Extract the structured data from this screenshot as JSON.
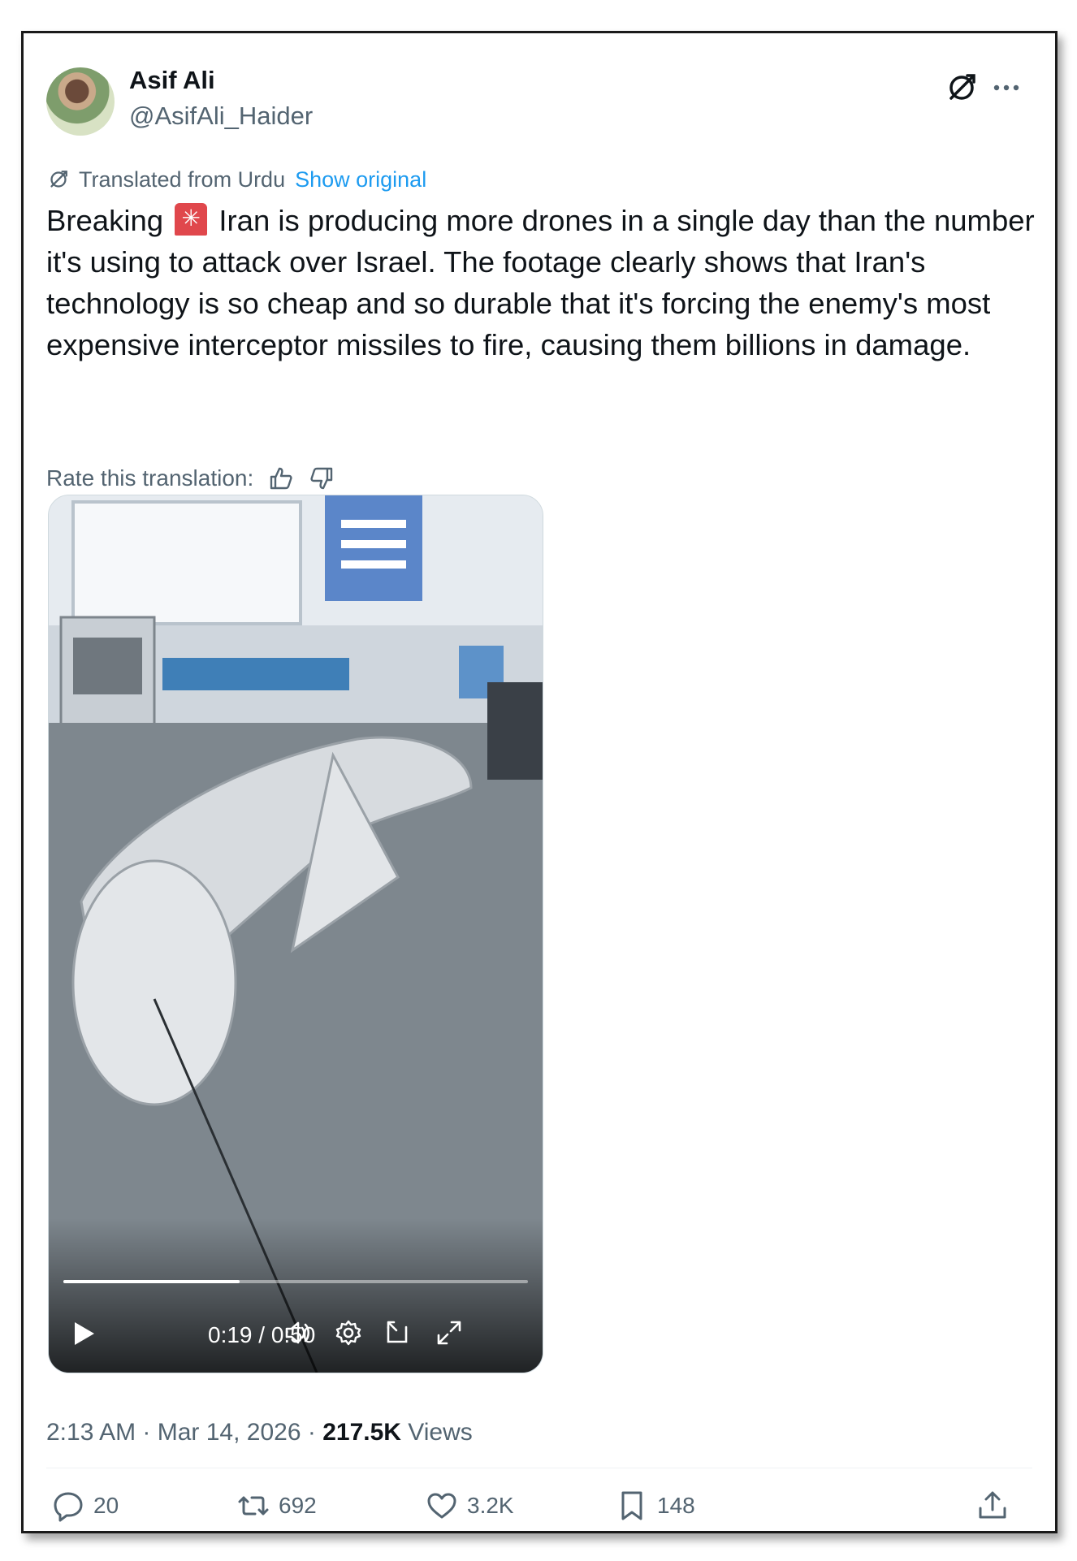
{
  "author": {
    "name": "Asif Ali",
    "handle": "@AsifAli_Haider"
  },
  "translation": {
    "label": "Translated from Urdu",
    "show_original": "Show original",
    "rate_label": "Rate this translation:"
  },
  "tweet": {
    "text_before": "Breaking",
    "text_after": " Iran is producing more drones in a single day than the number it's using to attack over Israel. The footage clearly shows that Iran's technology is so cheap and so durable that it's forcing the enemy's most expensive interceptor missiles to fire, causing them billions in damage."
  },
  "video": {
    "time": "0:19 / 0:50",
    "progress_fraction": 0.38
  },
  "meta": {
    "time": "2:13 AM",
    "date": "Mar 14, 2026",
    "views_count": "217.5K",
    "views_label": "Views"
  },
  "actions": {
    "replies": "20",
    "reposts": "692",
    "likes": "3.2K",
    "bookmarks": "148"
  },
  "colors": {
    "link": "#1d9bf0",
    "muted": "#536471",
    "text": "#0f1419"
  }
}
